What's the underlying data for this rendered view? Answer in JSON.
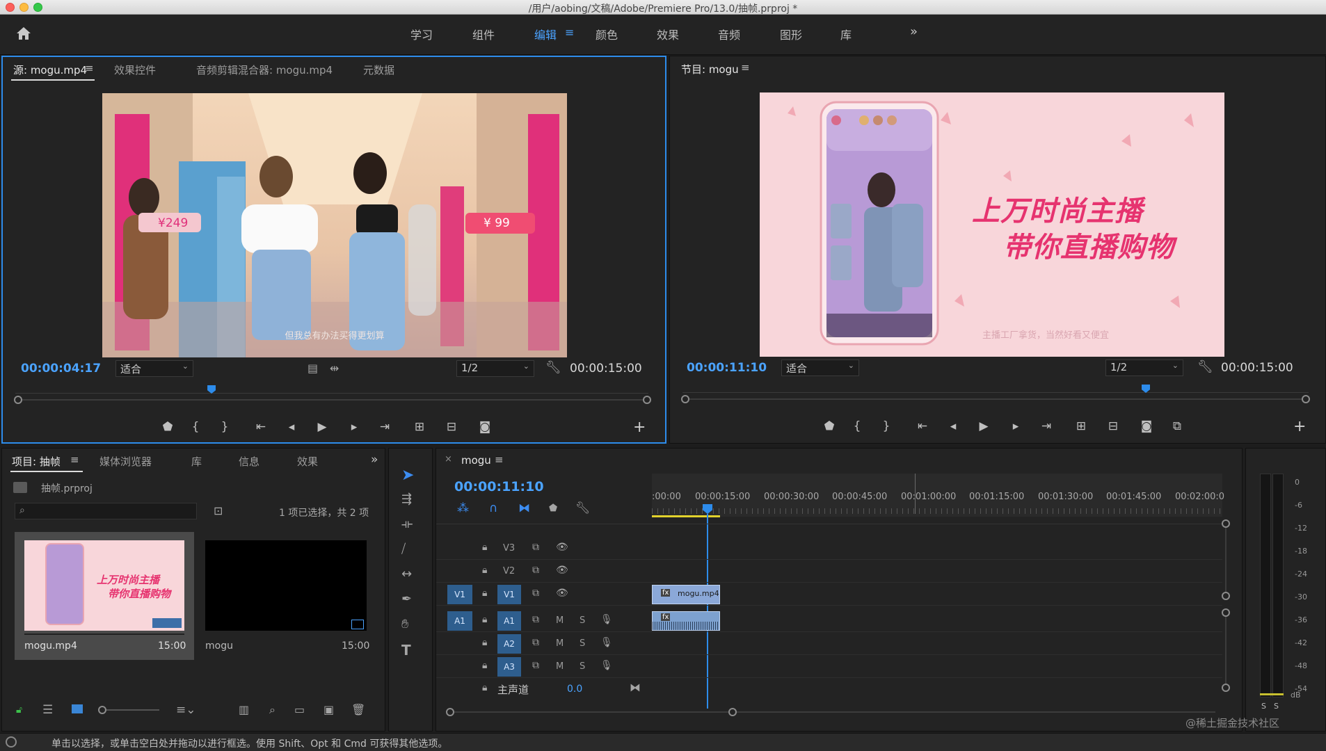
{
  "window": {
    "title": "/用户/aobing/文稿/Adobe/Premiere Pro/13.0/抽帧.prproj *"
  },
  "workspaces": [
    "学习",
    "组件",
    "编辑",
    "颜色",
    "效果",
    "音频",
    "图形",
    "库"
  ],
  "workspace_active_index": 2,
  "source_panel": {
    "tabs": [
      "源: mogu.mp4",
      "效果控件",
      "音频剪辑混合器: mogu.mp4",
      "元数据"
    ],
    "timecode": "00:00:04:17",
    "fit": "适合",
    "resolution": "1/2",
    "duration": "00:00:15:00",
    "price_tag_1": "¥249",
    "price_tag_2": "¥ 99",
    "subtitle": "但我总有办法买得更划算",
    "playhead_fraction": 0.31
  },
  "program_panel": {
    "tab": "节目: mogu",
    "timecode": "00:00:11:10",
    "fit": "适合",
    "resolution": "1/2",
    "duration": "00:00:15:00",
    "headline_1": "上万时尚主播",
    "headline_2": "带你直播购物",
    "subtitle": "主播工厂拿货，当然好看又便宜",
    "playhead_fraction": 0.74
  },
  "project_panel": {
    "tabs": [
      "项目: 抽帧",
      "媒体浏览器",
      "库",
      "信息",
      "效果"
    ],
    "project_file": "抽帧.prproj",
    "search_placeholder": "",
    "selection_info": "1 项已选择，共 2 项",
    "items": [
      {
        "name": "mogu.mp4",
        "duration": "15:00"
      },
      {
        "name": "mogu",
        "duration": "15:00"
      }
    ],
    "thumb_text_1": "上万时尚主播",
    "thumb_text_2": "带你直播购物"
  },
  "timeline": {
    "sequence_name": "mogu",
    "timecode": "00:00:11:10",
    "ruler_labels": [
      ":00:00",
      "00:00:15:00",
      "00:00:30:00",
      "00:00:45:00",
      "00:01:00:00",
      "00:01:15:00",
      "00:01:30:00",
      "00:01:45:00",
      "00:02:00:0"
    ],
    "video_tracks": [
      "V3",
      "V2",
      "V1"
    ],
    "audio_tracks": [
      "A1",
      "A2",
      "A3"
    ],
    "source_patch_video": "V1",
    "source_patch_audio": "A1",
    "mute_label": "M",
    "solo_label": "S",
    "master": {
      "label": "主声道",
      "value": "0.0"
    },
    "clip_video": "mogu.mp4",
    "clip_fx_badge": "fx"
  },
  "meter": {
    "scale": [
      "0",
      "-6",
      "-12",
      "-18",
      "-24",
      "-30",
      "-36",
      "-42",
      "-48",
      "-54",
      "dB"
    ],
    "solo_buttons": [
      "S",
      "S"
    ]
  },
  "statusbar": {
    "message": "单击以选择，或单击空白处并拖动以进行框选。使用 Shift、Opt 和 Cmd 可获得其他选项。"
  },
  "watermark": "@稀土掘金技术社区"
}
